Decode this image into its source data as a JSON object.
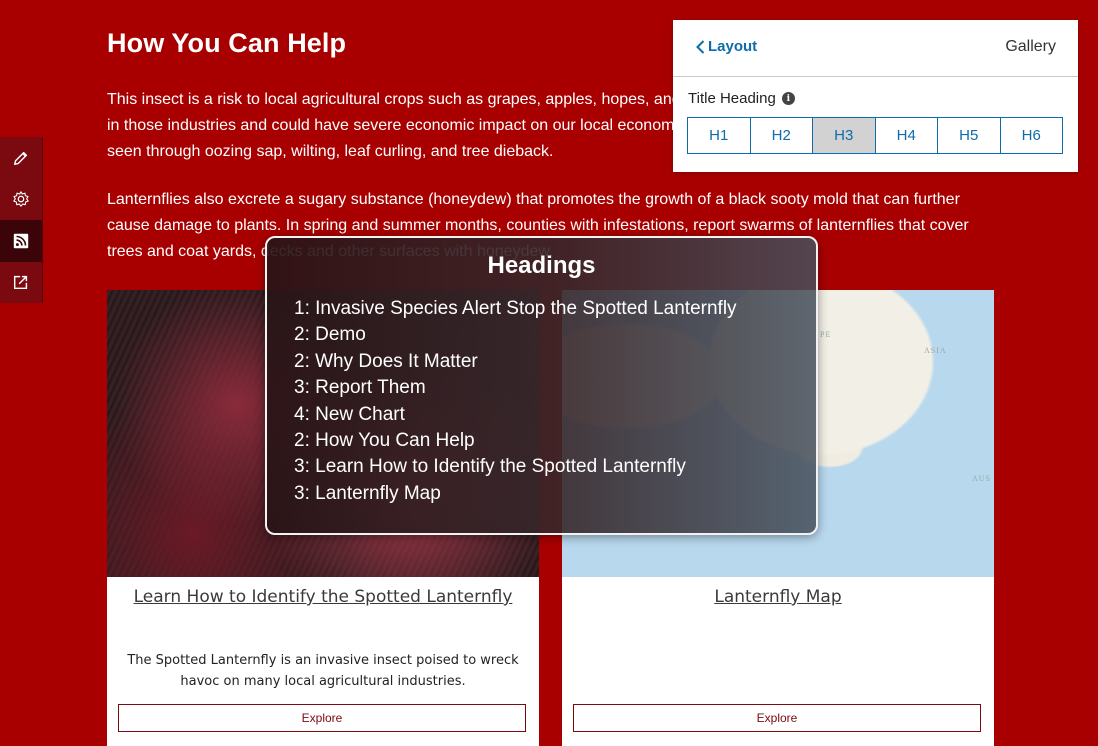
{
  "article": {
    "title": "How You Can Help",
    "paragraph1": "This insect is a risk to local agricultural crops such as grapes, apples, hopes, and hardwoods which supports thousands of jobs in those industries and could have severe economic impact on our local economy. They cause significant damage to trees seen through oozing sap, wilting, leaf curling, and tree dieback.",
    "paragraph2": "Lanternflies also excrete a sugary substance (honeydew) that promotes the growth of a black sooty mold that can further cause damage to plants. In spring and summer months, counties with infestations, report swarms of lanternflies that cover trees and coat yards, decks and other surfaces with honeydew."
  },
  "toolbar": {
    "items": [
      {
        "name": "edit",
        "icon": "pencil-icon"
      },
      {
        "name": "settings",
        "icon": "gear-icon"
      },
      {
        "name": "feed",
        "icon": "rss-icon"
      },
      {
        "name": "share",
        "icon": "share-icon"
      }
    ],
    "active_index": 2
  },
  "cards": [
    {
      "link": "Learn How to Identify the Spotted Lanternfly",
      "description": "The Spotted Lanternfly is an invasive insect poised to wreck havoc on many local agricultural industries.",
      "button": "Explore"
    },
    {
      "link": "Lanternfly Map",
      "description": "",
      "button": "Explore",
      "map_labels": [
        "PE",
        "ASIA",
        "AUS"
      ]
    }
  ],
  "layout_panel": {
    "back_label": "Layout",
    "tab_label": "Gallery",
    "field_label": "Title Heading",
    "options": [
      "H1",
      "H2",
      "H3",
      "H4",
      "H5",
      "H6"
    ],
    "selected": "H3"
  },
  "headings_overlay": {
    "title": "Headings",
    "items": [
      "1: Invasive Species Alert Stop the Spotted Lanternfly",
      "2: Demo",
      "2: Why Does It Matter",
      "3: Report Them",
      "4: New Chart",
      "2: How You Can Help",
      "3: Learn How to Identify the Spotted Lanternfly",
      "3: Lanternfly Map"
    ]
  },
  "colors": {
    "page_background": "#a80000",
    "accent_blue": "#0e6cab",
    "button_border": "#7a0a10"
  }
}
